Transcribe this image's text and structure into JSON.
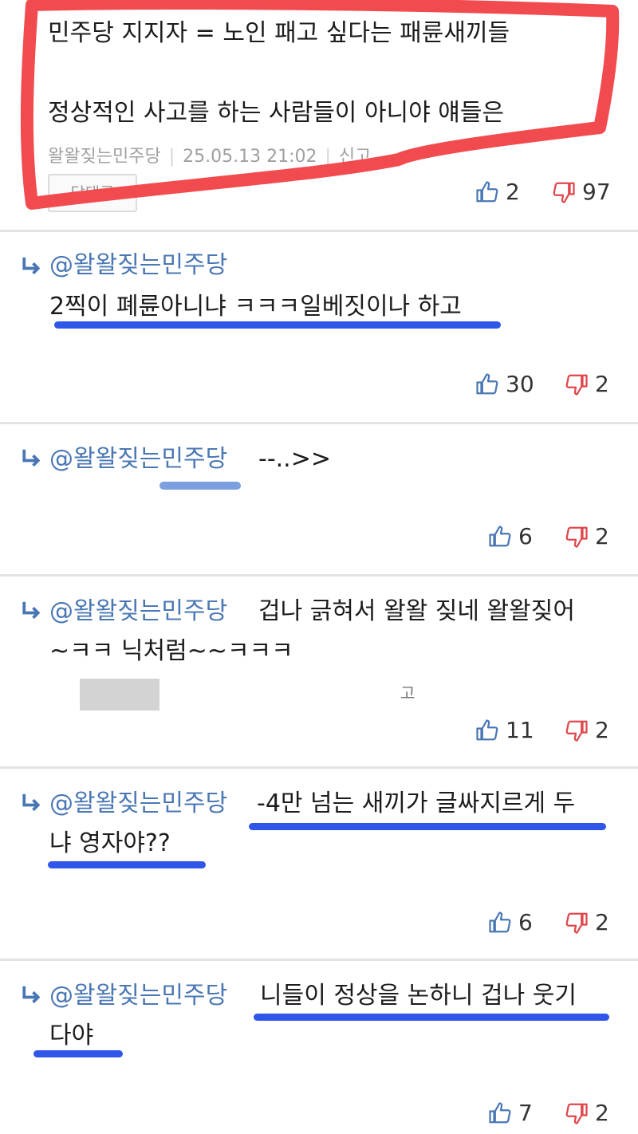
{
  "top_comment": {
    "line1": "민주당 지지자 = 노인 패고 싶다는 패륜새끼들",
    "line2": "정상적인 사고를 하는 사람들이 아니야 얘들은",
    "author": "왈왈짖는민주당",
    "timestamp": "25.05.13  21:02",
    "report_label": "신고",
    "reply_label": "답댓글",
    "likes": "2",
    "dislikes": "97"
  },
  "replies": [
    {
      "mention": "@왈왈짖는민주당",
      "text_after": "",
      "line2": "2찍이 폐륜아니냐 ㅋㅋㅋ일베짓이나 하고",
      "likes": "30",
      "dislikes": "2"
    },
    {
      "mention": "@왈왈짖는민주당",
      "text_after": "--..>>",
      "line2": "",
      "likes": "6",
      "dislikes": "2"
    },
    {
      "mention": "@왈왈짖는민주당",
      "text_after": "겁나 긁혀서 왈왈 짖네 왈왈짖어",
      "line2": "~ㅋㅋ 닉처럼~~ㅋㅋㅋ",
      "extra": "고",
      "likes": "11",
      "dislikes": "2"
    },
    {
      "mention": "@왈왈짖는민주당",
      "text_after": "-4만 넘는 새끼가 글싸지르게 두",
      "line2": "냐 영자야??",
      "likes": "6",
      "dislikes": "2"
    },
    {
      "mention": "@왈왈짖는민주당",
      "text_after": "니들이 정상을 논하니 겁나 웃기",
      "line2": "다야",
      "likes": "7",
      "dislikes": "2"
    }
  ],
  "colors": {
    "mention": "#4a77b4",
    "like_icon": "#4a77b4",
    "dislike_icon": "#e0474c",
    "highlight_frame": "#f24b4f",
    "underline": "#2f56e8"
  },
  "icons": {
    "like": "thumbs-up-icon",
    "dislike": "thumbs-down-icon",
    "reply": "reply-arrow-icon"
  }
}
